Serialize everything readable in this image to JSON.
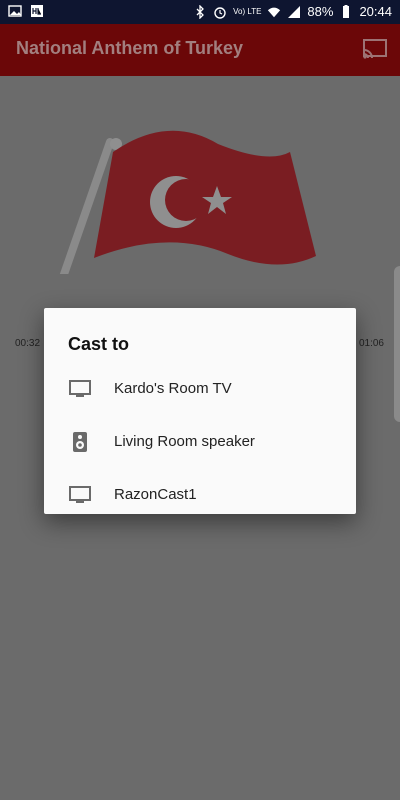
{
  "status_bar": {
    "battery": "88%",
    "time": "20:44",
    "network_label": "Vo) LTE",
    "left_icons": [
      "gallery-icon",
      "app-icon"
    ],
    "right_icons": [
      "bluetooth-icon",
      "alarm-icon",
      "volte-icon",
      "wifi-icon",
      "signal-icon",
      "battery-icon"
    ]
  },
  "app_bar": {
    "title": "National Anthem of Turkey",
    "cast_icon": "cast-icon"
  },
  "content": {
    "time_left": "00:32",
    "time_right": "01:06",
    "image": "turkey-flag"
  },
  "dialog": {
    "title": "Cast to",
    "devices": [
      {
        "label": "Kardo's Room TV",
        "icon": "tv-icon"
      },
      {
        "label": "Living Room speaker",
        "icon": "speaker-icon"
      },
      {
        "label": "RazonCast1",
        "icon": "tv-icon"
      }
    ]
  },
  "colors": {
    "app_bar_dim": "#6b0708",
    "scrim": "#6b6b6b",
    "dialog_bg": "#fafafa",
    "flag_red_dim": "#7a1d22"
  }
}
